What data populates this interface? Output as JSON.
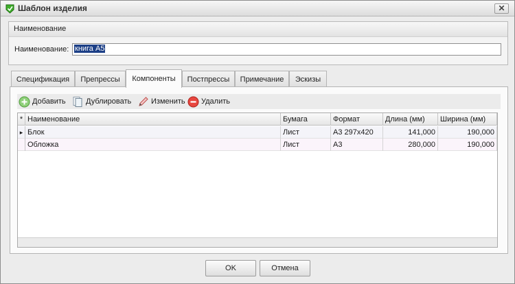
{
  "window": {
    "title": "Шаблон изделия"
  },
  "name_group": {
    "header": "Наименование",
    "label": "Наименование:",
    "value": "книга А5"
  },
  "tabs": [
    {
      "label": "Спецификация",
      "active": false
    },
    {
      "label": "Препрессы",
      "active": false
    },
    {
      "label": "Компоненты",
      "active": true
    },
    {
      "label": "Постпрессы",
      "active": false
    },
    {
      "label": "Примечание",
      "active": false
    },
    {
      "label": "Эскизы",
      "active": false
    }
  ],
  "toolbar": {
    "add_label": "Добавить",
    "duplicate_label": "Дублировать",
    "edit_label": "Изменить",
    "delete_label": "Удалить"
  },
  "grid": {
    "indicator_header": "*",
    "columns": [
      "Наименование",
      "Бумага",
      "Формат",
      "Длина (мм)",
      "Ширина (мм)"
    ],
    "rows": [
      {
        "indicator": "▸",
        "name": "Блок",
        "paper": "Лист",
        "format": "А3 297х420",
        "length": "141,000",
        "width": "190,000"
      },
      {
        "indicator": "",
        "name": "Обложка",
        "paper": "Лист",
        "format": "А3",
        "length": "280,000",
        "width": "190,000"
      }
    ]
  },
  "buttons": {
    "ok": "OK",
    "cancel": "Отмена"
  },
  "colors": {
    "selection": "#1c3f86",
    "app_icon": "#3fae2a"
  }
}
